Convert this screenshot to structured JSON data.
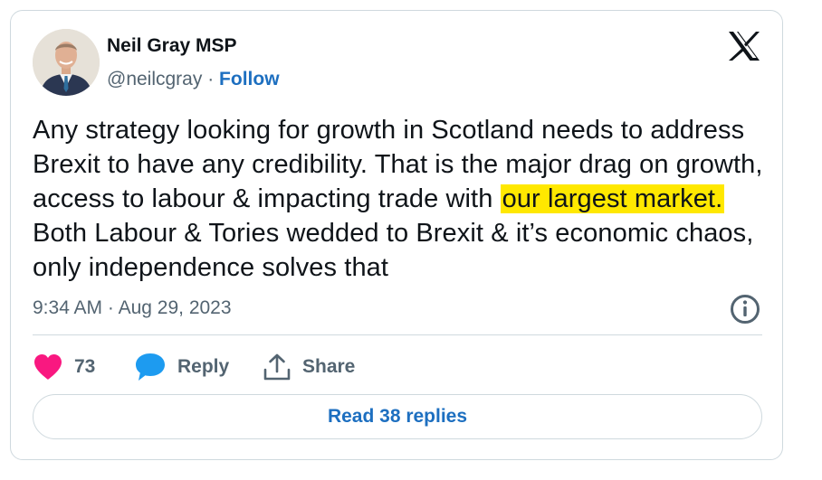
{
  "author": {
    "name": "Neil Gray MSP",
    "handle": "@neilcgray",
    "separator": "·",
    "follow_label": "Follow"
  },
  "tweet": {
    "text_before": "Any strategy looking for growth in Scotland needs to address Brexit to have any credibility. That is the major drag on growth, access to labour & impacting trade with ",
    "text_highlight": "our largest market.",
    "text_after": " Both Labour & Tories wedded to Brexit & it’s economic chaos, only independence solves that",
    "time": "9:34 AM",
    "date_separator": "·",
    "date": "Aug 29, 2023"
  },
  "actions": {
    "like_count": "73",
    "reply_label": "Reply",
    "share_label": "Share"
  },
  "read_replies_label": "Read 38 replies",
  "colors": {
    "highlight": "#ffe800",
    "like_heart": "#f91880",
    "reply_bubble": "#1d9bf0",
    "link_blue": "#1d6fc0",
    "muted_text": "#536471",
    "border": "#cfd9de"
  },
  "icons": {
    "avatar": "avatar",
    "brand": "x-logo-icon",
    "info": "info-icon",
    "like": "heart-icon",
    "reply": "speech-bubble-icon",
    "share": "share-upload-icon"
  }
}
